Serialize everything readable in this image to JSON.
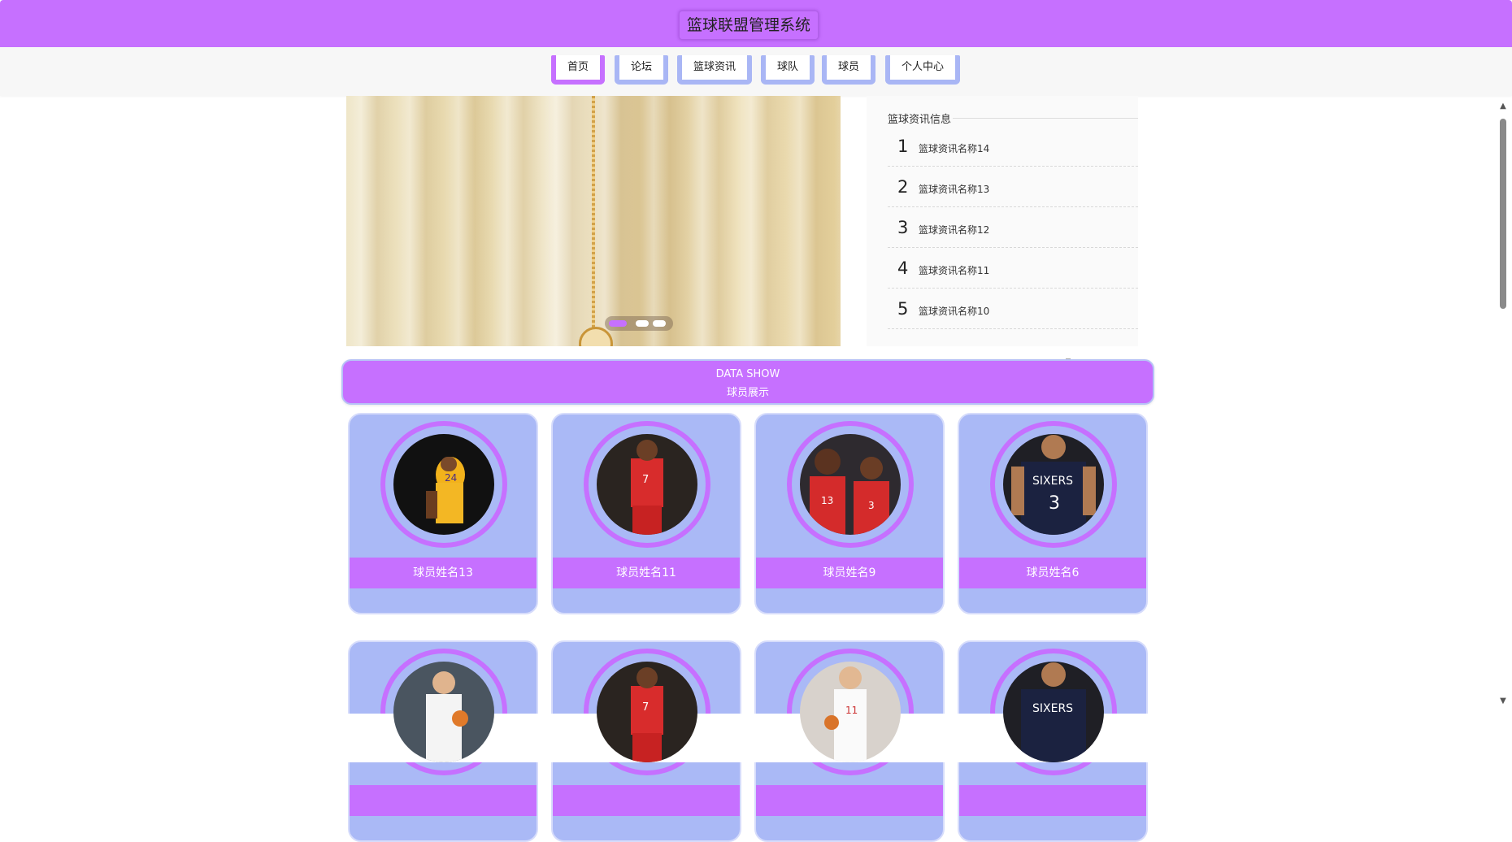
{
  "header": {
    "title": "篮球联盟管理系统"
  },
  "nav": {
    "items": [
      {
        "label": "首页",
        "active": true
      },
      {
        "label": "论坛",
        "active": false
      },
      {
        "label": "篮球资讯",
        "active": false
      },
      {
        "label": "球队",
        "active": false
      },
      {
        "label": "球员",
        "active": false
      },
      {
        "label": "个人中心",
        "active": false
      }
    ]
  },
  "carousel": {
    "slide_count": 3,
    "active_index": 0
  },
  "news": {
    "title": "篮球资讯信息",
    "items": [
      {
        "num": "1",
        "title": "篮球资讯名称14"
      },
      {
        "num": "2",
        "title": "篮球资讯名称13"
      },
      {
        "num": "3",
        "title": "篮球资讯名称12"
      },
      {
        "num": "4",
        "title": "篮球资讯名称11"
      },
      {
        "num": "5",
        "title": "篮球资讯名称10"
      }
    ]
  },
  "section": {
    "title_en": "DATA SHOW",
    "title_cn": "球员展示"
  },
  "players": [
    {
      "name": "球员姓名13",
      "photo": "player-photo-yellow-jersey"
    },
    {
      "name": "球员姓名11",
      "photo": "player-photo-red-jersey"
    },
    {
      "name": "球员姓名9",
      "photo": "player-photo-red-jersey-duo"
    },
    {
      "name": "球员姓名6",
      "photo": "player-photo-navy-jersey"
    },
    {
      "name": "",
      "photo": "player-photo-white-jersey"
    },
    {
      "name": "",
      "photo": "player-photo-red-jersey"
    },
    {
      "name": "",
      "photo": "player-photo-white-jersey"
    },
    {
      "name": "",
      "photo": "player-photo-navy-jersey"
    }
  ],
  "colors": {
    "primary": "#c670ff",
    "card": "#aab9f6",
    "card_border": "#d6dcfb"
  }
}
